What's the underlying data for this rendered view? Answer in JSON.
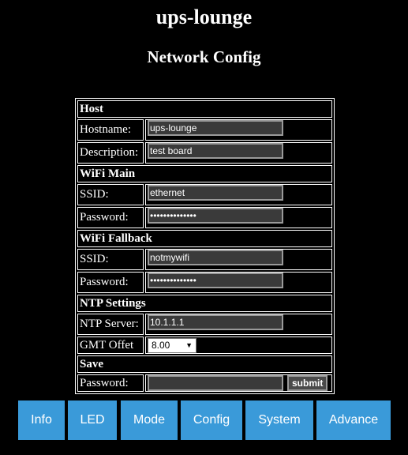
{
  "page": {
    "title": "ups-lounge",
    "heading": "Network Config"
  },
  "host": {
    "title": "Host",
    "hostname_label": "Hostname:",
    "hostname_value": "ups-lounge",
    "description_label": "Description:",
    "description_value": "test board"
  },
  "wifi_main": {
    "title": "WiFi Main",
    "ssid_label": "SSID:",
    "ssid_value": "ethernet",
    "password_label": "Password:",
    "password_value": "••••••••••••••"
  },
  "wifi_fallback": {
    "title": "WiFi Fallback",
    "ssid_label": "SSID:",
    "ssid_value": "notmywifi",
    "password_label": "Password:",
    "password_value": "••••••••••••••"
  },
  "ntp": {
    "title": "NTP Settings",
    "server_label": "NTP Server:",
    "server_value": "10.1.1.1",
    "gmt_label": "GMT Offet",
    "gmt_value": "8.00"
  },
  "save": {
    "title": "Save",
    "password_label": "Password:",
    "password_value": "",
    "submit_label": "submit"
  },
  "nav": {
    "items": [
      {
        "label": "Info"
      },
      {
        "label": "LED"
      },
      {
        "label": "Mode"
      },
      {
        "label": "Config"
      },
      {
        "label": "System"
      },
      {
        "label": "Advance"
      }
    ]
  },
  "colors": {
    "background": "#000000",
    "nav_button": "#3a9ad9",
    "text": "#ffffff"
  }
}
